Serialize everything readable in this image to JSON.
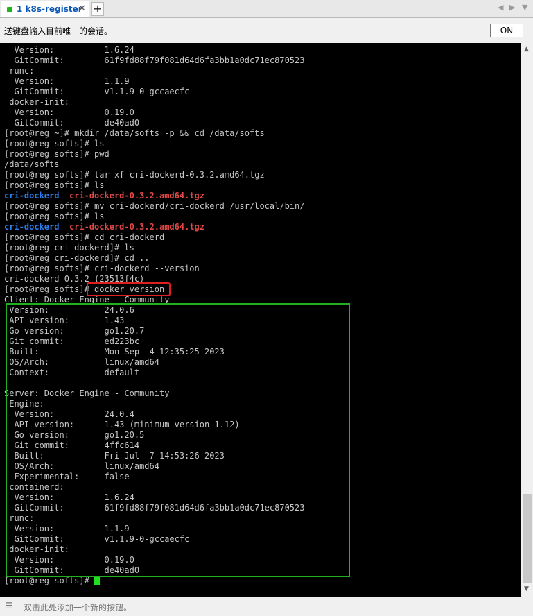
{
  "tabbar": {
    "tab_label": "1 k8s-register",
    "close_glyph": "✕",
    "new_tab_glyph": "+",
    "nav_left_glyph": "◀",
    "nav_right_glyph": "▶",
    "nav_down_glyph": "▼"
  },
  "broadcast": {
    "text": "送键盘输入目前唯一的会话。",
    "button_label": "ON"
  },
  "colors": {
    "terminal_bg": "#000000",
    "terminal_fg": "#c8c8c8",
    "directory": "#2e7de8",
    "archive": "#e04848",
    "highlight_red": "#e02020",
    "highlight_green": "#20b020",
    "cursor": "#1ee01e"
  },
  "terminal": {
    "lines": [
      "  Version:          1.6.24",
      "  GitCommit:        61f9fd88f79f081d64d6fa3bb1a0dc71ec870523",
      " runc:",
      "  Version:          1.1.9",
      "  GitCommit:        v1.1.9-0-gccaecfc",
      " docker-init:",
      "  Version:          0.19.0",
      "  GitCommit:        de40ad0",
      "[root@reg ~]# mkdir /data/softs -p && cd /data/softs",
      "[root@reg softs]# ls",
      "[root@reg softs]# pwd",
      "/data/softs",
      "[root@reg softs]# tar xf cri-dockerd-0.3.2.amd64.tgz",
      "[root@reg softs]# ls",
      "",
      "[root@reg softs]# mv cri-dockerd/cri-dockerd /usr/local/bin/",
      "[root@reg softs]# ls",
      "",
      "[root@reg softs]# cd cri-dockerd",
      "[root@reg cri-dockerd]# ls",
      "[root@reg cri-dockerd]# cd ..",
      "[root@reg softs]# cri-dockerd --version",
      "cri-dockerd 0.3.2 (23513f4c)",
      "[root@reg softs]# docker version",
      "Client: Docker Engine - Community",
      " Version:           24.0.6",
      " API version:       1.43",
      " Go version:        go1.20.7",
      " Git commit:        ed223bc",
      " Built:             Mon Sep  4 12:35:25 2023",
      " OS/Arch:           linux/amd64",
      " Context:           default",
      "",
      "Server: Docker Engine - Community",
      " Engine:",
      "  Version:          24.0.4",
      "  API version:      1.43 (minimum version 1.12)",
      "  Go version:       go1.20.5",
      "  Git commit:       4ffc614",
      "  Built:            Fri Jul  7 14:53:26 2023",
      "  OS/Arch:          linux/amd64",
      "  Experimental:     false",
      " containerd:",
      "  Version:          1.6.24",
      "  GitCommit:        61f9fd88f79f081d64d6fa3bb1a0dc71ec870523",
      " runc:",
      "  Version:          1.1.9",
      "  GitCommit:        v1.1.9-0-gccaecfc",
      " docker-init:",
      "  Version:          0.19.0",
      "  GitCommit:        de40ad0",
      "[root@reg softs]# "
    ],
    "ls_output_1": {
      "dir": "cri-dockerd",
      "archive": "cri-dockerd-0.3.2.amd64.tgz"
    },
    "ls_output_2": {
      "dir": "cri-dockerd",
      "archive": "cri-dockerd-0.3.2.amd64.tgz"
    }
  },
  "footer": {
    "menu_glyph": "☰",
    "text": "双击此处添加一个新的按钮。"
  }
}
